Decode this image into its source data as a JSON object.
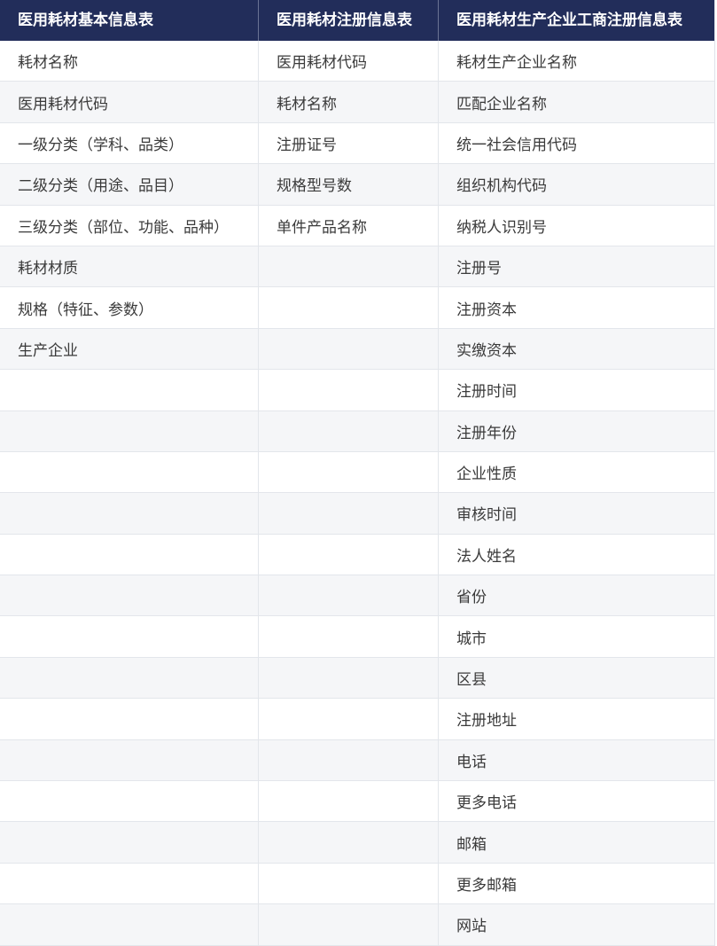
{
  "headers": [
    "医用耗材基本信息表",
    "医用耗材注册信息表",
    "医用耗材生产企业工商注册信息表"
  ],
  "rows": [
    [
      "耗材名称",
      "医用耗材代码",
      "耗材生产企业名称"
    ],
    [
      "医用耗材代码",
      "耗材名称",
      "匹配企业名称"
    ],
    [
      "一级分类（学科、品类）",
      "注册证号",
      "统一社会信用代码"
    ],
    [
      "二级分类（用途、品目）",
      "规格型号数",
      "组织机构代码"
    ],
    [
      "三级分类（部位、功能、品种）",
      "单件产品名称",
      "纳税人识别号"
    ],
    [
      "耗材材质",
      "",
      "注册号"
    ],
    [
      "规格（特征、参数）",
      "",
      "注册资本"
    ],
    [
      "生产企业",
      "",
      "实缴资本"
    ],
    [
      "",
      "",
      "注册时间"
    ],
    [
      "",
      "",
      "注册年份"
    ],
    [
      "",
      "",
      "企业性质"
    ],
    [
      "",
      "",
      "审核时间"
    ],
    [
      "",
      "",
      "法人姓名"
    ],
    [
      "",
      "",
      "省份"
    ],
    [
      "",
      "",
      "城市"
    ],
    [
      "",
      "",
      "区县"
    ],
    [
      "",
      "",
      "注册地址"
    ],
    [
      "",
      "",
      "电话"
    ],
    [
      "",
      "",
      "更多电话"
    ],
    [
      "",
      "",
      "邮箱"
    ],
    [
      "",
      "",
      "更多邮箱"
    ],
    [
      "",
      "",
      "网站"
    ]
  ]
}
